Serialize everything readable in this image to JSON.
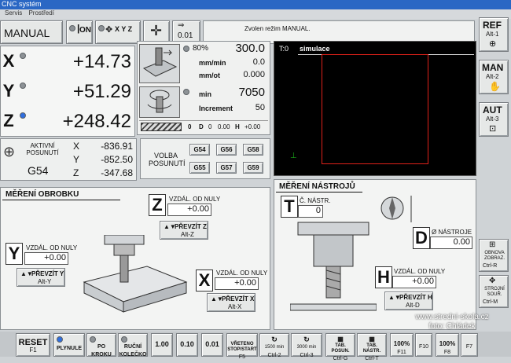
{
  "window": {
    "title": "CNC systém",
    "menu": [
      "Servis",
      "Prostředí"
    ]
  },
  "top": {
    "mode": "MANUAL",
    "on_label": "ON",
    "axes_label": "X Y Z",
    "step_value": "0.01",
    "status": "Zvolen režim MANUAL."
  },
  "positions": [
    {
      "axis": "X",
      "value": "+14.73"
    },
    {
      "axis": "Y",
      "value": "+51.29"
    },
    {
      "axis": "Z",
      "value": "+248.42"
    }
  ],
  "feed": {
    "percent": "80%",
    "value": "300.0",
    "mmmin_label": "mm/min",
    "mmmin_value": "0.0",
    "mmot_label": "mm/ot",
    "mmot_value": "0.000"
  },
  "spindle": {
    "unit": "min",
    "value": "7050",
    "increment_label": "Increment",
    "increment_value": "50"
  },
  "tool_row": {
    "tool": "0",
    "d_label": "D",
    "d_value": "0",
    "pos": "0.00",
    "h_label": "H",
    "h_value": "+0.00"
  },
  "active_offset": {
    "label": "AKTIVNÍ POSUNUTÍ",
    "code": "G54",
    "values": [
      {
        "axis": "X",
        "value": "-836.91"
      },
      {
        "axis": "Y",
        "value": "-852.50"
      },
      {
        "axis": "Z",
        "value": "-347.68"
      }
    ]
  },
  "offset_select": {
    "label": "VOLBA POSUNUTÍ",
    "codes": [
      "G54",
      "G56",
      "G58",
      "G55",
      "G57",
      "G59"
    ]
  },
  "sim": {
    "t_label": "T:0",
    "title": "simulace"
  },
  "side_buttons": [
    {
      "label": "REF",
      "hint": "Alt-1"
    },
    {
      "label": "MAN",
      "hint": "Alt-2"
    },
    {
      "label": "AUT",
      "hint": "Alt-3"
    }
  ],
  "workpiece": {
    "title": "MĚŘENÍ OBROBKU",
    "dist_label": "VZDÁL. OD NULY",
    "z_value": "+0.00",
    "y_value": "+0.00",
    "x_value": "+0.00",
    "btn_z": {
      "label": "PŘEVZÍT Z",
      "hint": "Alt-Z"
    },
    "btn_y": {
      "label": "PŘEVZÍT Y",
      "hint": "Alt-Y"
    },
    "btn_x": {
      "label": "PŘEVZÍT X",
      "hint": "Alt-X"
    }
  },
  "tool_meas": {
    "title": "MĚŘENÍ NÁSTROJŮ",
    "tool_no_label": "Č. NÁSTR.",
    "tool_no_value": "0",
    "diam_label": "Ø NÁSTROJE",
    "diam_value": "0.00",
    "dist_label": "VZDÁL. OD NULY",
    "h_value": "+0.00",
    "btn_h": {
      "label": "PŘEVZÍT H",
      "hint": "Alt-D"
    }
  },
  "right_tools": [
    {
      "label": "OBNOVA ZOBRAZ.",
      "hint": "Ctrl-R"
    },
    {
      "label": "STROJNÍ SOUŘ.",
      "hint": "Ctrl-M"
    }
  ],
  "watermark": {
    "line1": "www.stredni-skola.cz",
    "line2": "foto: Chládek"
  },
  "bottom": [
    {
      "label": "RESET",
      "hint": "F1"
    },
    {
      "label": "PLYNULE",
      "hint": ""
    },
    {
      "label": "PO KROKU",
      "hint": ""
    },
    {
      "label": "RUČNÍ KOLEČKO",
      "hint": ""
    },
    {
      "label": "1.00",
      "hint": ""
    },
    {
      "label": "0.10",
      "hint": ""
    },
    {
      "label": "0.01",
      "hint": ""
    },
    {
      "label": "VŘETENO STOP/START",
      "hint": "F5"
    },
    {
      "label": "1500 min",
      "hint": "Ctrl-2"
    },
    {
      "label": "3000 min",
      "hint": "Ctrl-3"
    },
    {
      "label": "TAB. POSUN.",
      "hint": "Ctrl-G"
    },
    {
      "label": "TAB. NÁSTR.",
      "hint": "Ctrl-T"
    },
    {
      "label": "100%",
      "hint": "F11"
    },
    {
      "label": "F10",
      "hint": ""
    },
    {
      "label": "100%",
      "hint": "F8"
    },
    {
      "label": "F7",
      "hint": ""
    }
  ]
}
